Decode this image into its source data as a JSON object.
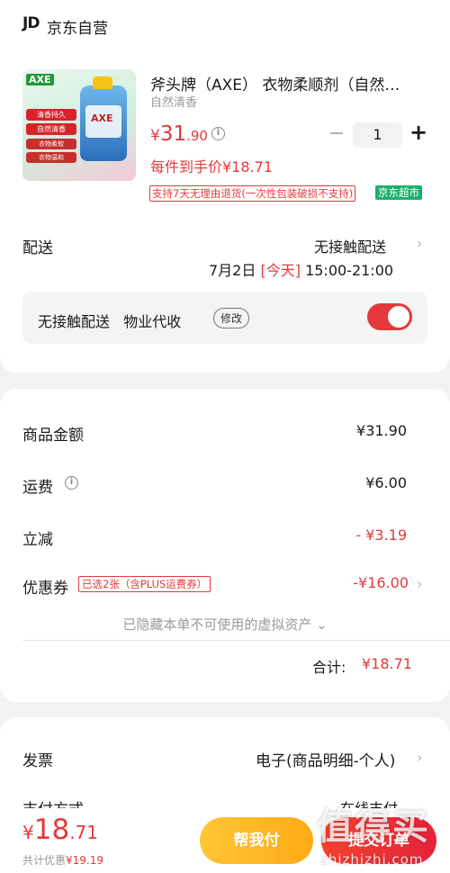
{
  "store": {
    "logo": "JD",
    "name": "京东自营"
  },
  "product": {
    "title": "斧头牌（AXE） 衣物柔顺剂（自然…",
    "variant": "自然清香",
    "price": {
      "symbol": "¥",
      "integer": "31",
      "decimal": ".90"
    },
    "quantity": "1",
    "minus": "−",
    "plus": "+",
    "unit_price": "每件到手价¥18.71",
    "return_policy": "支持7天无理由退货(一次性包装破损不支持)",
    "market_tag": "京东超市",
    "image_text": {
      "brand": "AXE",
      "bottle_brand": "AXE",
      "tags": [
        "清香持久",
        "自然清香",
        "衣物柔软",
        "衣物温和"
      ]
    }
  },
  "delivery": {
    "label": "配送",
    "method": "无接触配送",
    "date": "7月2日",
    "today": "[今天]",
    "time": "15:00-21:00",
    "contactless": {
      "text": "无接触配送   物业代收",
      "modify": "修改",
      "enabled": true
    }
  },
  "summary": {
    "items": [
      {
        "label": "商品金额",
        "value": "¥31.90",
        "highlight": false
      },
      {
        "label": "运费",
        "value": "¥6.00",
        "highlight": false
      },
      {
        "label": "立减",
        "value": "- ¥3.19",
        "highlight": true
      },
      {
        "label": "优惠券",
        "value": "-¥16.00",
        "highlight": true
      }
    ],
    "coupon_tag": "已选2张（含PLUS运费券）",
    "hidden_note": "已隐藏本单不可使用的虚拟资产",
    "total_label": "合计:",
    "total_value": "¥18.71"
  },
  "invoice": {
    "label": "发票",
    "value": "电子(商品明细-个人)"
  },
  "payment": {
    "label": "支付方式",
    "value": "在线支付"
  },
  "bottom_bar": {
    "price": {
      "symbol": "¥",
      "integer": "18",
      "decimal": ".71"
    },
    "discount_prefix": "共计优惠",
    "discount_value": "¥19.19",
    "help_pay": "帮我付",
    "submit": "提交订单"
  },
  "watermark": {
    "main": "值得买",
    "sub": "zhizhizhi.com"
  },
  "colors": {
    "accent": "#e4393c",
    "help_pay": "#ffb524",
    "market_tag": "#19b16a",
    "background": "#f2f2f2"
  }
}
